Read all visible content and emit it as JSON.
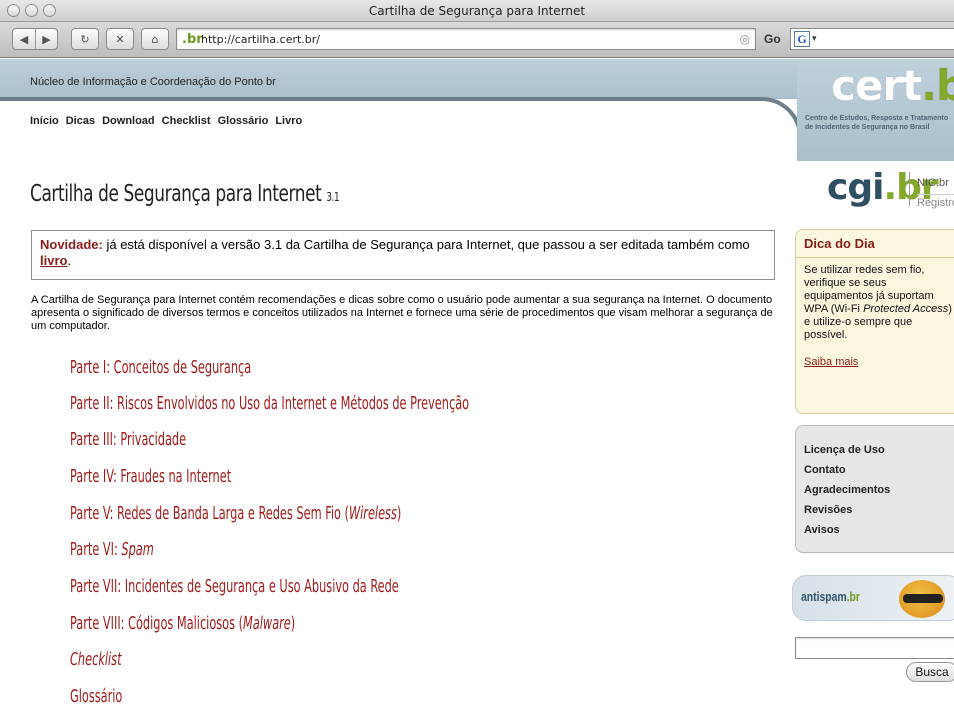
{
  "window": {
    "title": "Cartilha de Segurança para Internet"
  },
  "toolbar": {
    "back_icon": "◀",
    "forward_icon": "▶",
    "reload_icon": "↻",
    "stop_icon": "✕",
    "home_icon": "⌂",
    "address_favicon": ".br",
    "address_url": "http://cartilha.cert.br/",
    "go_label": "Go",
    "search_engine_icon": "G"
  },
  "header": {
    "org_name": "Núcleo de Informação e Coordenação do Ponto br",
    "nav": [
      "Início",
      "Dicas",
      "Download",
      "Checklist",
      "Glossário",
      "Livro"
    ],
    "logo_cert": "cert",
    "logo_br": ".br",
    "logo_subtitle": "Centro de Estudos, Resposta e Tratamento de Incidentes de Segurança no Brasil",
    "logo_cgi": "cgi",
    "logo_cgi_br": ".br",
    "nic": "NIC.br",
    "registro": "Registro"
  },
  "main": {
    "title": "Cartilha de Segurança para Internet",
    "title_version": "3.1",
    "notice_label": "Novidade:",
    "notice_text": "já está disponível a versão 3.1 da Cartilha de Segurança para Internet, que passou a ser editada também como",
    "notice_link": "livro",
    "notice_end": ".",
    "intro": "A Cartilha de Segurança para Internet contém recomendações e dicas sobre como o usuário pode aumentar a sua segurança na Internet. O documento apresenta o significado de diversos termos e conceitos utilizados na Internet e fornece uma série de procedimentos que visam melhorar a segurança de um computador.",
    "toc": {
      "p1": "Parte I: Conceitos de Segurança",
      "p2": "Parte II: Riscos Envolvidos no Uso da Internet e Métodos de Prevenção",
      "p3": "Parte III: Privacidade",
      "p4": "Parte IV: Fraudes na Internet",
      "p5_prefix": "Parte V: Redes de Banda Larga e Redes Sem Fio (",
      "p5_italic": "Wireless",
      "p5_suffix": ")",
      "p6_prefix": "Parte VI: ",
      "p6_italic": "Spam",
      "p7": "Parte VII: Incidentes de Segurança e Uso Abusivo da Rede",
      "p8_prefix": "Parte VIII: Códigos Maliciosos (",
      "p8_italic": "Malware",
      "p8_suffix": ")",
      "checklist": "Checklist",
      "glossario": "Glossário"
    }
  },
  "sidebar": {
    "dica_title": "Dica do Dia",
    "dica_text_1": "Se utilizar redes sem fio, verifique se seus equipamentos já suportam WPA (Wi-Fi",
    "dica_text_italic": "Protected Access",
    "dica_text_2": ") e utilize-o sempre que possível.",
    "dica_link": "Saiba mais",
    "links": [
      "Licença de Uso",
      "Contato",
      "Agradecimentos",
      "Revisões",
      "Avisos"
    ],
    "antispam": "antispam",
    "antispam_br": ".br",
    "search_button": "Busca"
  }
}
